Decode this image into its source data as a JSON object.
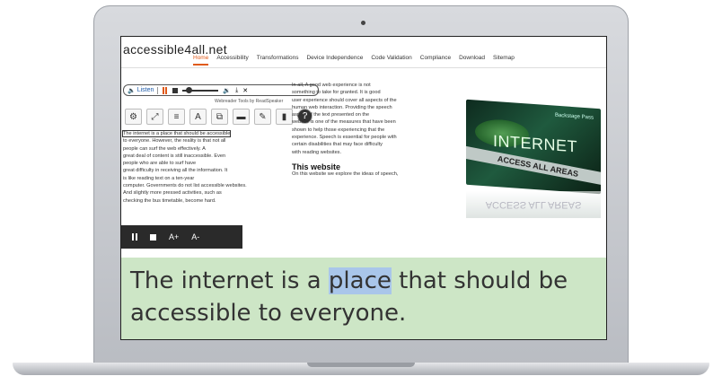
{
  "site": {
    "logo": "accessible4all.net",
    "nav": [
      "Home",
      "Accessibility",
      "Transformations",
      "Device Independence",
      "Code Validation",
      "Compliance",
      "Download",
      "Sitemap"
    ],
    "active_nav_index": 0
  },
  "player": {
    "listen_label": "Listen",
    "credit": "Webreader Tools by ReadSpeaker"
  },
  "toolbar": {
    "icons": [
      "settings-icon",
      "enlarge-icon",
      "text-mode-icon",
      "page-mask-icon",
      "popup-icon",
      "play-icon",
      "dictionary-icon",
      "book-icon",
      "help-icon"
    ]
  },
  "content": {
    "col1": [
      "The internet is a place that should be accessible",
      "to everyone. However, the reality is that not all",
      "people can surf the web effectively. A",
      "great deal of content is still inaccessible. Even",
      "people who are able to surf have",
      "great difficulty in receiving all the information. It",
      "is like reading text on a ten-year",
      "computer. Governments do not list accessible websites.",
      "And slightly more pressed activities, such as",
      "checking the bus timetable, become hard."
    ],
    "col2": [
      "In all, A good web experience is not",
      "something to take for granted. It is good",
      "user experience should cover all aspects of the",
      "human web interaction. Providing the speech",
      "aspect of the text presented on the",
      "website is one of the measures that have been",
      "shown to help those experiencing that the",
      "experience. Speech is essential for people with",
      "certain disabilities that may face difficulty",
      "with reading websites."
    ],
    "col2_heading": "This website",
    "col2_after": "On this website we explore the ideas of speech,"
  },
  "promo": {
    "badge": "Backstage Pass",
    "big": "INTERNET",
    "band": "ACCESS ALL AREAS",
    "reflection": "ACCESS ALL AREAS"
  },
  "overlay": {
    "increase_label": "A+",
    "decrease_label": "A-"
  },
  "reading": {
    "before": "The internet is a ",
    "highlighted_word": "place",
    "after": " that should be accessible to everyone."
  }
}
